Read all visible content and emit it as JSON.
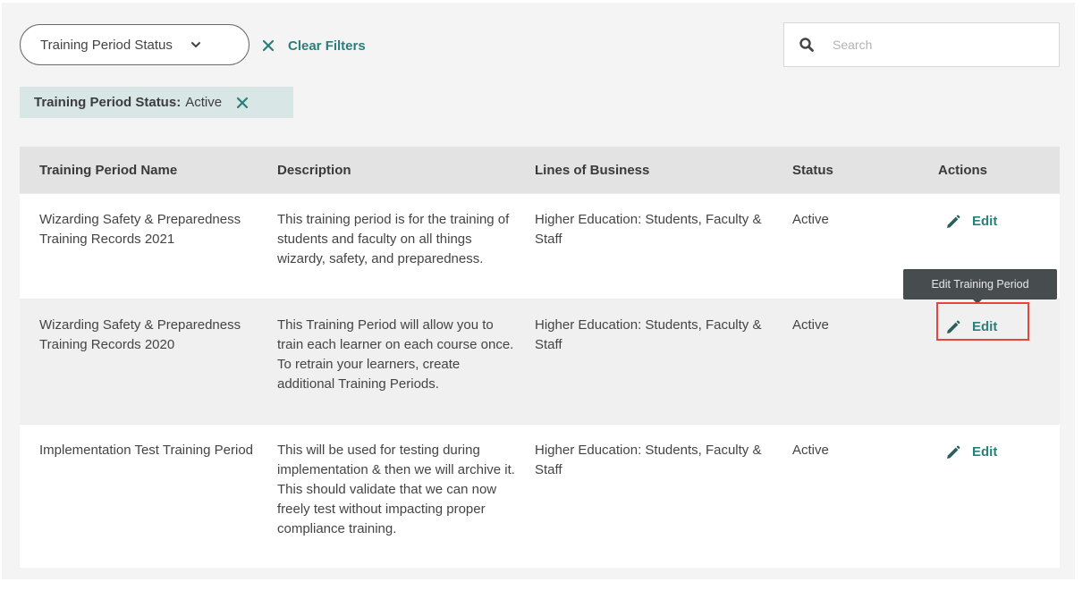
{
  "filters": {
    "dropdown_label": "Training Period Status",
    "clear_label": "Clear Filters",
    "search_placeholder": "Search",
    "search_value": "",
    "active_chip": {
      "key": "Training Period Status:",
      "value": "Active"
    }
  },
  "table": {
    "columns": [
      "Training Period Name",
      "Description",
      "Lines of Business",
      "Status",
      "Actions"
    ],
    "rows": [
      {
        "name": "Wizarding Safety & Preparedness Training Records 2021",
        "description": "This training period is for the training of students and faculty on all things wizardy, safety, and preparedness.",
        "lines_of_business": "Higher Education: Students, Faculty & Staff",
        "status": "Active",
        "action_label": "Edit"
      },
      {
        "name": "Wizarding Safety & Preparedness Training Records 2020",
        "description": "This Training Period will allow you to train each learner on each course once. To retrain your learners, create additional Training Periods.",
        "lines_of_business": "Higher Education: Students, Faculty & Staff",
        "status": "Active",
        "action_label": "Edit"
      },
      {
        "name": "Implementation Test Training Period",
        "description": "This will be used for testing during implementation & then we will archive it. This should validate that we can now freely test without impacting proper compliance training.",
        "lines_of_business": "Higher Education: Students, Faculty & Staff",
        "status": "Active",
        "action_label": "Edit"
      }
    ]
  },
  "tooltip": {
    "text": "Edit Training Period"
  },
  "colors": {
    "accent": "#2a7f7a",
    "chip_bg": "#d9e6e6",
    "highlight": "#e5453b",
    "tooltip_bg": "#474d4e"
  },
  "icons": {
    "dropdown": "chevron-down-icon",
    "clear": "close-icon",
    "search": "search-icon",
    "chip_remove": "close-icon",
    "edit": "pencil-icon"
  }
}
